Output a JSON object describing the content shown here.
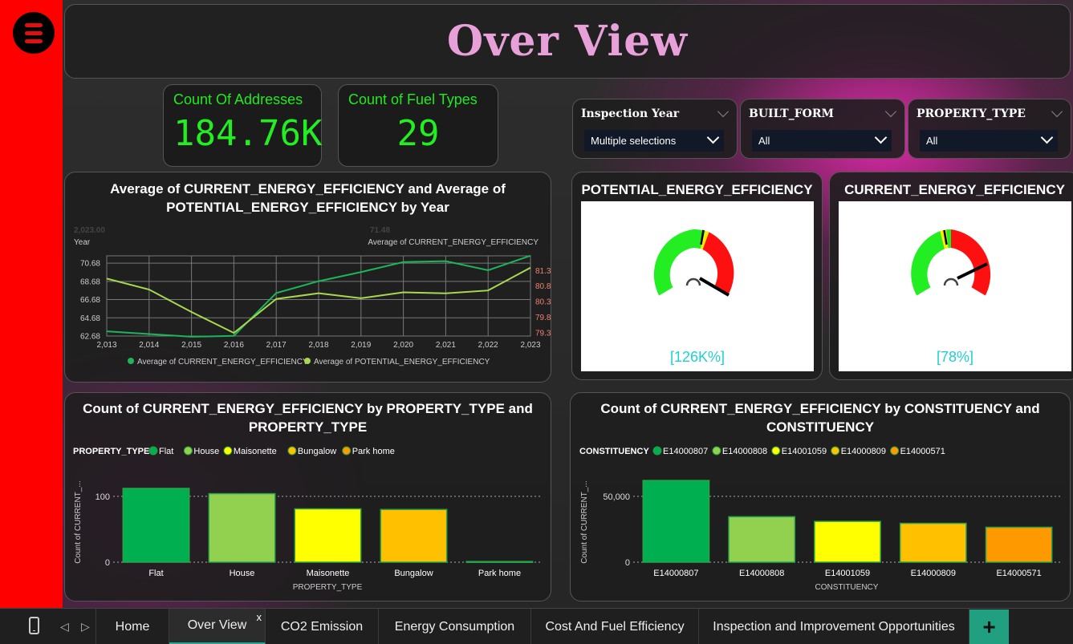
{
  "page": {
    "title": "Over View"
  },
  "kpis": [
    {
      "label": "Count Of Addresses",
      "value": "184.76K"
    },
    {
      "label": "Count of Fuel Types",
      "value": "29"
    }
  ],
  "slicers": [
    {
      "title": "Inspection Year",
      "value": "Multiple selections"
    },
    {
      "title": "BUILT_FORM",
      "value": "All"
    },
    {
      "title": "PROPERTY_TYPE",
      "value": "All"
    }
  ],
  "gauges": [
    {
      "title": "POTENTIAL_ENERGY_EFFICIENCY",
      "value_label": "[126K%]"
    },
    {
      "title": "CURRENT_ENERGY_EFFICIENCY",
      "value_label": "[78%]"
    }
  ],
  "line_chart": {
    "title_line1": "Average of CURRENT_ENERGY_EFFICIENCY and Average of",
    "title_line2": "POTENTIAL_ENERGY_EFFICIENCY by Year",
    "faded_left": "2,023.00",
    "faded_right": "71.48",
    "left_axis_label": "Year",
    "right_axis_label": "Average of CURRENT_ENERGY_EFFICIENCY"
  },
  "bar_chart_1": {
    "title_line1": "Count of CURRENT_ENERGY_EFFICIENCY by PROPERTY_TYPE and",
    "title_line2": "PROPERTY_TYPE",
    "legend_title": "PROPERTY_TYPE",
    "ylabel": "Count of CURRENT_...",
    "xlabel": "PROPERTY_TYPE"
  },
  "bar_chart_2": {
    "title_line1": "Count of CURRENT_ENERGY_EFFICIENCY by CONSTITUENCY and",
    "title_line2": "CONSTITUENCY",
    "legend_title": "CONSTITUENCY",
    "ylabel": "Count of CURRENT_...",
    "xlabel": "CONSTITUENCY"
  },
  "colors": {
    "accent_green": "#22e822",
    "title_pink": "#e8a0d8",
    "series_current": "#1db45a",
    "series_potential": "#a8d850",
    "palette": [
      "#00b050",
      "#92d050",
      "#ffff00",
      "#ffc000",
      "#ff9900"
    ]
  },
  "chart_data": [
    {
      "type": "line",
      "x": [
        2013,
        2014,
        2015,
        2016,
        2017,
        2018,
        2019,
        2020,
        2021,
        2022,
        2023
      ],
      "x_tick_labels": [
        "2,013",
        "2,014",
        "2,015",
        "2,016",
        "2,017",
        "2,018",
        "2,019",
        "2,020",
        "2,021",
        "2,022",
        "2,023"
      ],
      "y_left_ticks": [
        "70.68",
        "68.68",
        "66.68",
        "64.68",
        "62.68"
      ],
      "y_right_ticks": [
        "81.33",
        "80.83",
        "80.33",
        "79.83",
        "79.33"
      ],
      "ylim_left": [
        62.68,
        71.48
      ],
      "ylim_right": [
        79.23,
        81.8
      ],
      "series": [
        {
          "name": "Average of CURRENT_ENERGY_EFFICIENCY",
          "axis": "left",
          "values": [
            63.2,
            62.9,
            62.6,
            62.7,
            67.4,
            68.7,
            69.7,
            70.8,
            70.9,
            69.9,
            71.5
          ]
        },
        {
          "name": "Average of POTENTIAL_ENERGY_EFFICIENCY",
          "axis": "right",
          "values": [
            81.07,
            80.72,
            80.0,
            79.33,
            80.42,
            80.6,
            80.44,
            80.63,
            80.6,
            80.69,
            81.42
          ]
        }
      ]
    },
    {
      "type": "bar",
      "categories": [
        "Flat",
        "House",
        "Maisonette",
        "Bungalow",
        "Park home"
      ],
      "values": [
        112,
        104,
        81,
        80,
        1
      ],
      "ylim": [
        0,
        140
      ],
      "yticks": [
        {
          "v": 0,
          "label": "0"
        },
        {
          "v": 100,
          "label": "100"
        }
      ]
    },
    {
      "type": "bar",
      "categories": [
        "E14000807",
        "E14000808",
        "E14001059",
        "E14000809",
        "E14000571"
      ],
      "values": [
        62000,
        34500,
        31000,
        29500,
        26500
      ],
      "ylim": [
        0,
        70000
      ],
      "yticks": [
        {
          "v": 0,
          "label": "0"
        },
        {
          "v": 50000,
          "label": "50,000"
        }
      ]
    }
  ],
  "tabs": [
    {
      "label": "Home"
    },
    {
      "label": "Over View",
      "active": true
    },
    {
      "label": "CO2 Emission"
    },
    {
      "label": "Energy Consumption"
    },
    {
      "label": "Cost And Fuel Efficiency"
    },
    {
      "label": "Inspection and Improvement Opportunities"
    }
  ],
  "tab_close": "x",
  "add_tab": "+",
  "nav": {
    "prev": "◁",
    "next": "▷"
  }
}
